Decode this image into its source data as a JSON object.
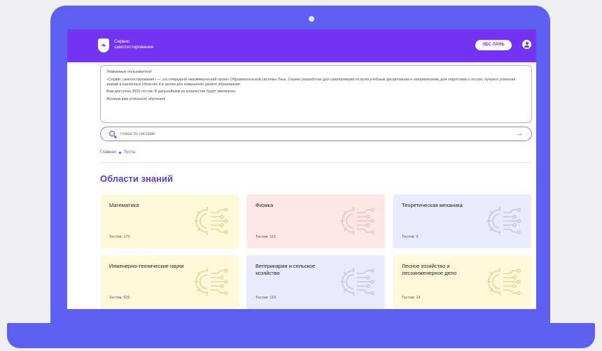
{
  "header": {
    "logo_mark": "❧",
    "logo_line1": "Сервис",
    "logo_line2": "самотестирования",
    "ebs_button": "ЭБС ЛАНЬ",
    "user_icon": "user-icon"
  },
  "notice": {
    "greeting": "Уважаемые пользователи!",
    "paragraph": "«Сервис самотестирования» — это очередной некоммерческий проект Образовательной системы Лань. Сервис разработан для самопроверки по всем учебным дисциплинам и направлениям, для подготовки к сессии, лучшего усвоения знаний в различных областях и в целом для повышения уровня образования.",
    "available": "Вам доступны 3500 тестов. В дальнейшем их количество будет увеличено.",
    "wish": "Желаем вам успешного обучения!"
  },
  "search": {
    "placeholder": "Поиск по системе",
    "submit_icon": "→"
  },
  "breadcrumb": {
    "home": "Главная",
    "current": "Тесты"
  },
  "section_title": "Области знаний",
  "colors": {
    "header": "#7433f2",
    "accent": "#5e3ad8",
    "card_yellow": "#fff8d9",
    "card_pink": "#fde7e7",
    "card_lavender": "#e9eafb"
  },
  "cards": [
    {
      "title": "Математика",
      "count": "Тестов: 170"
    },
    {
      "title": "Физика",
      "count": "Тестов: 115"
    },
    {
      "title": "Теоретическая механика",
      "count": "Тестов: 9"
    },
    {
      "title": "Инженерно-технические науки",
      "count": "Тестов: 625"
    },
    {
      "title": "Ветеринария и сельское хозяйство",
      "count": "Тестов: 119"
    },
    {
      "title": "Лесное хозяйство и лесоинженерное дело",
      "count": "Тестов: 14"
    }
  ]
}
